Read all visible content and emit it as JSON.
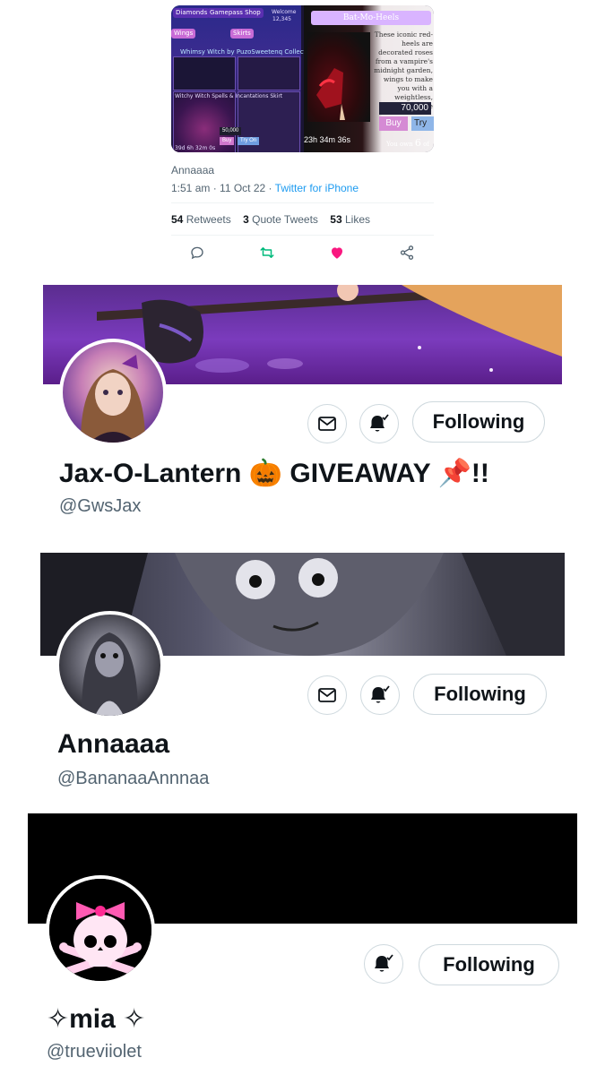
{
  "tweet": {
    "media_left": {
      "chips": [
        "Diamonds",
        "Gamepass Shop",
        "Welcome",
        "12,345",
        "Wings",
        "Skirts"
      ],
      "texts": [
        "Whimsy Witch by PuzoSweetenq Collection",
        "Witchy Witch Spells & Incantations Skirt",
        "39d 6h 32m 0s",
        "50,000",
        "Buy",
        "Try On"
      ]
    },
    "media_right": {
      "title": "Bat-Mo-Heels",
      "description": "These iconic red-heels are decorated roses from a vampire's midnight garden, wings to make you with a weightless, effortless stride",
      "price": "70,000",
      "buy_label": "Buy",
      "try_label": "Try",
      "timer": "23h 34m 36s",
      "own_prefix": "You own",
      "own_count": "6",
      "own_suffix": "of"
    },
    "author": "Annaaaa",
    "time": "1:51 am",
    "date": "11 Oct 22",
    "source": "Twitter for iPhone",
    "stats": {
      "retweets_count": "54",
      "retweets_label": "Retweets",
      "quotes_count": "3",
      "quotes_label": "Quote Tweets",
      "likes_count": "53",
      "likes_label": "Likes"
    },
    "colors": {
      "retweet": "#00ba7c",
      "like": "#f91880",
      "link": "#1d9bf0"
    }
  },
  "profiles": [
    {
      "display_name": "Jax-O-Lantern 🎃 GIVEAWAY 📌!!",
      "handle": "@GwsJax",
      "follow_label": "Following",
      "has_message": true,
      "icons": [
        "mail-icon",
        "bell-check-icon"
      ]
    },
    {
      "display_name": "Annaaaa",
      "handle": "@BananaaAnnnaa",
      "follow_label": "Following",
      "has_message": true,
      "icons": [
        "mail-icon",
        "bell-check-icon"
      ]
    },
    {
      "display_name": "✧mia ✧",
      "handle": "@trueviiolet",
      "follow_label": "Following",
      "has_message": false,
      "icons": [
        "bell-check-icon"
      ]
    }
  ]
}
